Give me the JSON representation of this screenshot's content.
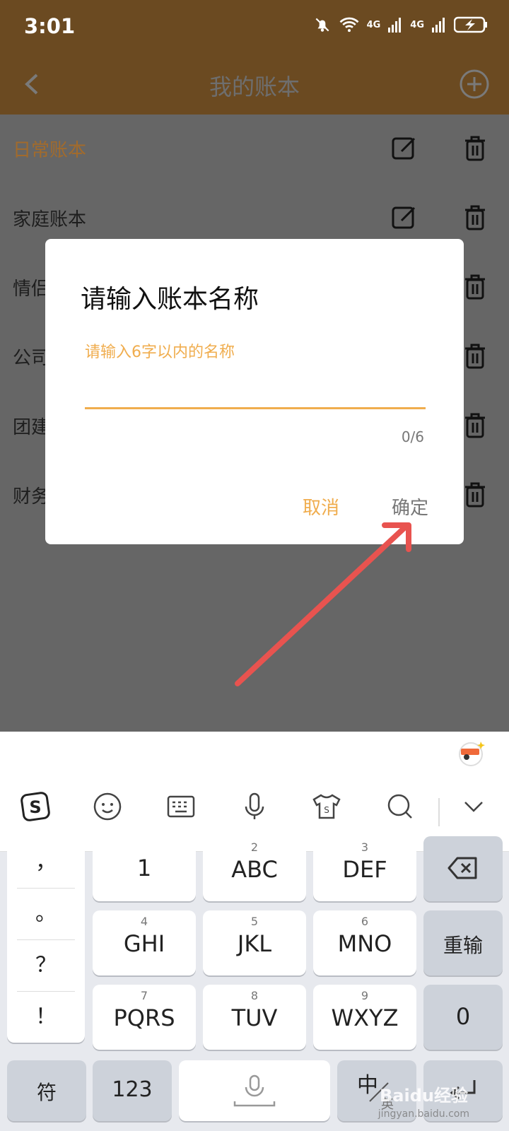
{
  "status": {
    "time": "3:01",
    "network_left": "4G",
    "network_right": "4G"
  },
  "nav": {
    "title": "我的账本"
  },
  "books": [
    {
      "label": "日常账本",
      "active": true
    },
    {
      "label": "家庭账本"
    },
    {
      "label": "情侣"
    },
    {
      "label": "公司"
    },
    {
      "label": "团建"
    },
    {
      "label": "财务"
    }
  ],
  "dialog": {
    "title": "请输入账本名称",
    "placeholder": "请输入6字以内的名称",
    "counter": "0/6",
    "cancel": "取消",
    "confirm": "确定"
  },
  "keyboard": {
    "punctuation": [
      "，",
      "。",
      "？",
      "！"
    ],
    "keys": [
      {
        "num": "",
        "label": "1"
      },
      {
        "num": "2",
        "label": "ABC"
      },
      {
        "num": "3",
        "label": "DEF"
      },
      {
        "num": "4",
        "label": "GHI"
      },
      {
        "num": "5",
        "label": "JKL"
      },
      {
        "num": "6",
        "label": "MNO"
      },
      {
        "num": "7",
        "label": "PQRS"
      },
      {
        "num": "8",
        "label": "TUV"
      },
      {
        "num": "9",
        "label": "WXYZ"
      }
    ],
    "reenter": "重输",
    "zero": "0",
    "symbols": "符",
    "numbers": "123",
    "lang_main": "中",
    "lang_alt": "英"
  },
  "watermark": {
    "main": "Baidu经验",
    "sub": "jingyan.baidu.com"
  },
  "colors": {
    "accent": "#f0ad4e",
    "header": "#6b4a21",
    "overlay": "#666666",
    "arrow": "#e8534f"
  }
}
